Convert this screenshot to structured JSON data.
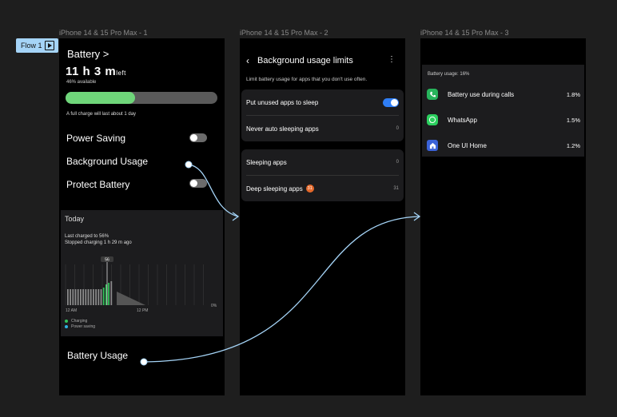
{
  "flow": {
    "label": "Flow 1"
  },
  "frames": [
    {
      "label": "iPhone 14 & 15 Pro Max - 1"
    },
    {
      "label": "iPhone 14 & 15 Pro Max - 2"
    },
    {
      "label": "iPhone 14 & 15 Pro Max - 3"
    }
  ],
  "screen1": {
    "title": "Battery >",
    "time_main": "11 h 3 m",
    "time_suffix": "left",
    "available": "46% available",
    "level_fraction": 0.46,
    "full_charge": "A full charge will last about 1 day",
    "power_saving": "Power Saving",
    "background_usage": "Background Usage",
    "protect_battery": "Protect Battery",
    "today": "Today",
    "last_charged": "Last charged to 56%",
    "stopped": "Stopped charging 1 h 29 m ago",
    "marker": "56",
    "axis": {
      "start": "12 AM",
      "mid": "12 PM",
      "pct": "0%"
    },
    "legend": {
      "charging": "Charging",
      "power_saving": "Power saving"
    },
    "battery_usage": "Battery Usage",
    "colors": {
      "charging": "#32c35a",
      "power_saving": "#2fb2e0",
      "bar_fill": "#6fd67a"
    }
  },
  "screen2": {
    "title": "Background usage limits",
    "subtitle": "Limit battery usage for apps that you don't use often.",
    "card1": [
      {
        "label": "Put unused apps to sleep",
        "toggle": true
      },
      {
        "label": "Never auto sleeping apps",
        "count": "0"
      }
    ],
    "card2": [
      {
        "label": "Sleeping apps",
        "count": "0"
      },
      {
        "label": "Deep sleeping apps",
        "badge": "31",
        "count": "31"
      }
    ]
  },
  "screen3": {
    "header": "Battery usage: 16%",
    "apps": [
      {
        "name": "Battery use during calls",
        "value": "1.8%",
        "icon": "phone-icon",
        "color": "#27b45c"
      },
      {
        "name": "WhatsApp",
        "value": "1.5%",
        "icon": "whatsapp-icon",
        "color": "#2bcf5e"
      },
      {
        "name": "One UI Home",
        "value": "1.2%",
        "icon": "home-icon",
        "color": "#3a62d8"
      }
    ]
  }
}
